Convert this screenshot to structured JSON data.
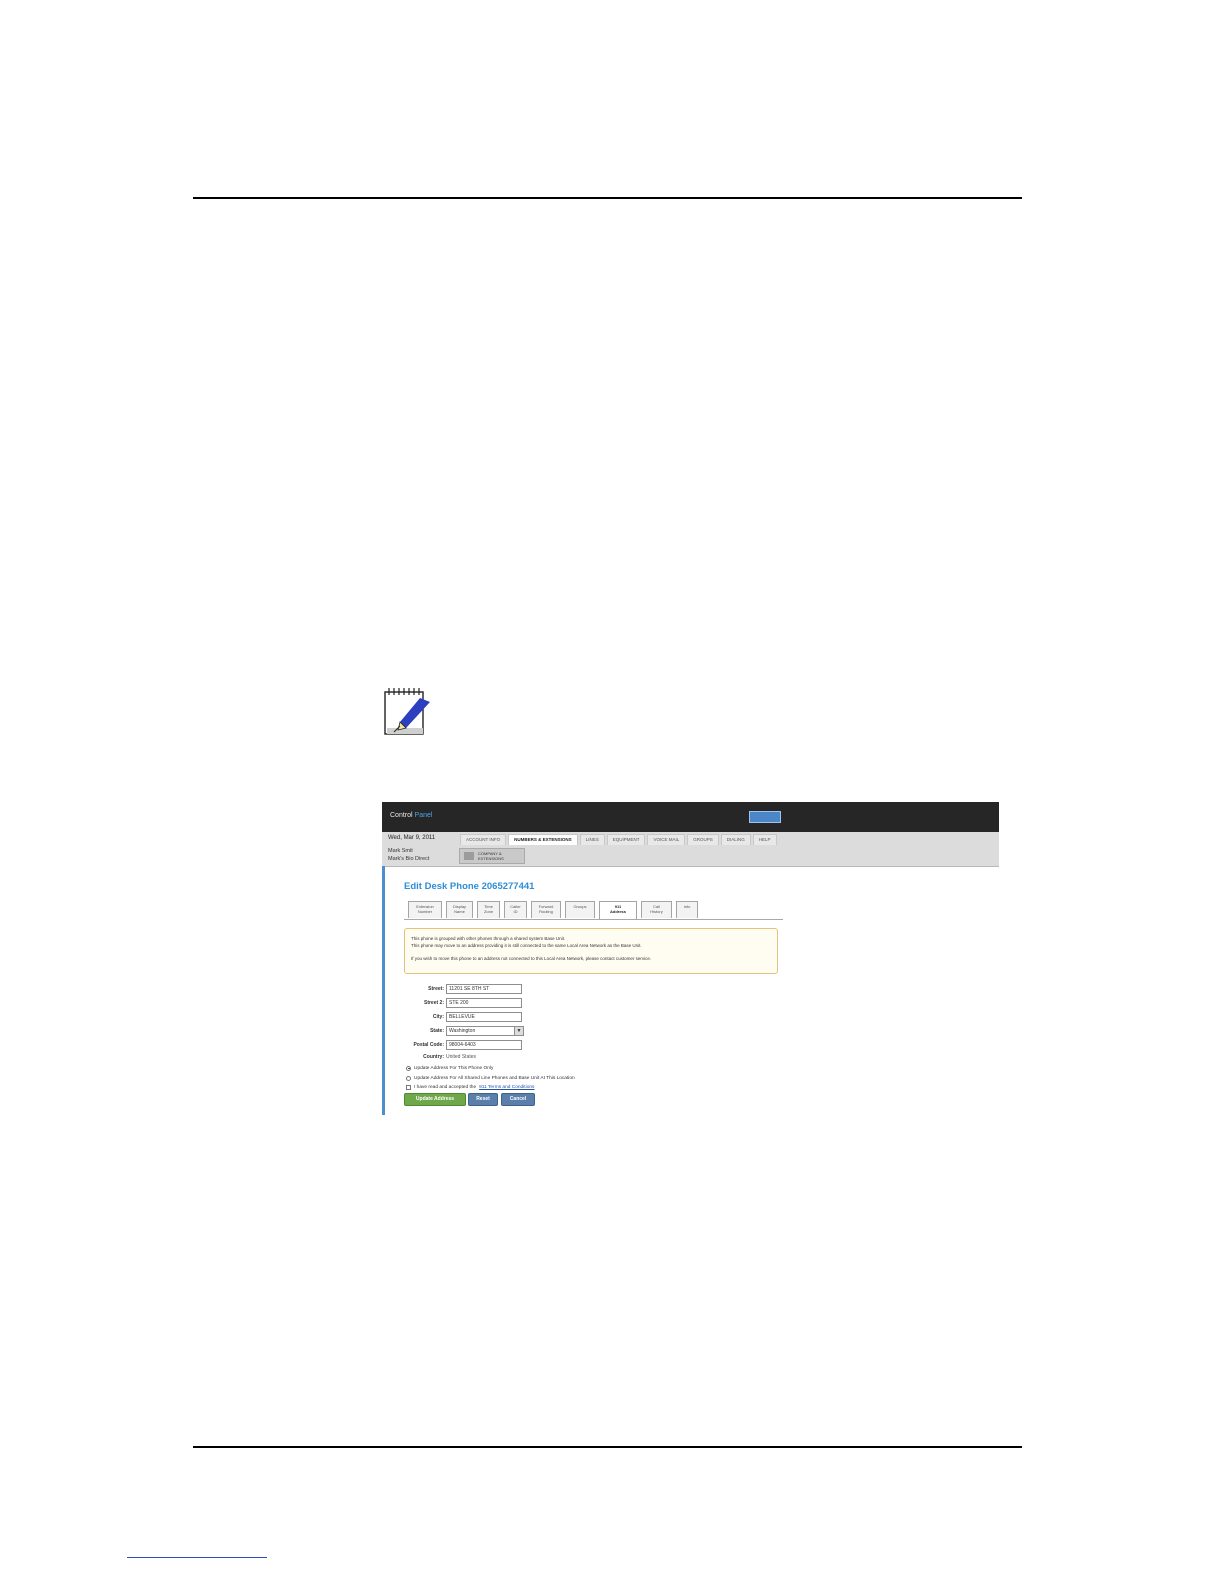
{
  "screenshot": {
    "brand": {
      "word1": "Control",
      "word2": "Panel"
    },
    "date": "Wed, Mar 9, 2011",
    "user": {
      "line1": "Mark Smit",
      "line2": "Mark's Bio Direct"
    },
    "nav_tabs": [
      {
        "label": "ACCOUNT INFO",
        "active": false
      },
      {
        "label": "NUMBERS & EXTENSIONS",
        "active": true
      },
      {
        "label": "LINES",
        "active": false
      },
      {
        "label": "EQUIPMENT",
        "active": false
      },
      {
        "label": "VOICE MAIL",
        "active": false
      },
      {
        "label": "GROUPS",
        "active": false
      },
      {
        "label": "DIALING",
        "active": false
      },
      {
        "label": "HELP",
        "active": false
      }
    ],
    "pill_label": "COMPANY & EXTENSIONS",
    "page_title": "Edit Desk Phone 2065277441",
    "sub_tabs": [
      {
        "line1": "Extension",
        "line2": "Number",
        "active": false
      },
      {
        "line1": "Display",
        "line2": "Name",
        "active": false
      },
      {
        "line1": "Time",
        "line2": "Zone",
        "active": false
      },
      {
        "line1": "Caller",
        "line2": "ID",
        "active": false
      },
      {
        "line1": "Forward",
        "line2": "Routing",
        "active": false
      },
      {
        "line1": "Groups",
        "line2": "",
        "active": false
      },
      {
        "line1": "911",
        "line2": "Address",
        "active": true
      },
      {
        "line1": "Call",
        "line2": "History",
        "active": false
      },
      {
        "line1": "Info",
        "line2": "",
        "active": false
      }
    ],
    "alert": {
      "line1": "This phone is grouped with other phones through a shared system Base Unit.",
      "line2": "This phone may move to an address providing it is still connected to the same Local Area Network as the Base Unit.",
      "line3": "If you wish to move this phone to an address not connected to this Local Area Network, please contact customer service."
    },
    "form": {
      "street_label": "Street:",
      "street_value": "11201 SE 8TH ST",
      "street2_label": "Street 2:",
      "street2_value": "STE 200",
      "city_label": "City:",
      "city_value": "BELLEVUE",
      "state_label": "State:",
      "state_value": "Washington",
      "postal_label": "Postal Code:",
      "postal_value": "98004-6403",
      "country_label": "Country:",
      "country_value": "United States"
    },
    "options": {
      "radio1": "Update Address For This Phone Only",
      "radio2": "Update Address For All Shared Line Phones and Base Unit At This Location",
      "checkbox_prefix": "I have read and accepted the",
      "checkbox_link": "911 Terms and Conditions"
    },
    "buttons": {
      "update": "Update Address",
      "reset": "Reset",
      "cancel": "Cancel"
    }
  }
}
